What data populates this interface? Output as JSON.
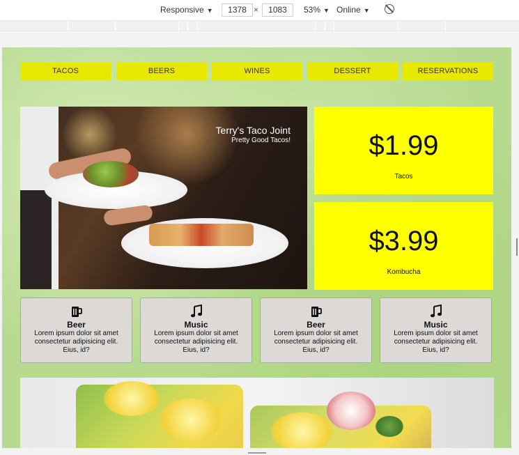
{
  "devtools": {
    "mode": "Responsive",
    "width": "1378",
    "times": "×",
    "height": "1083",
    "zoom": "53%",
    "network": "Online",
    "caret": "▼"
  },
  "nav": {
    "items": [
      {
        "label": "TACOS"
      },
      {
        "label": "BEERS"
      },
      {
        "label": "WINES"
      },
      {
        "label": "DESSERT"
      },
      {
        "label": "RESERVATIONS"
      }
    ]
  },
  "hero": {
    "title": "Terry's Taco Joint",
    "subtitle": "Pretty Good Tacos!"
  },
  "prices": [
    {
      "amount": "$1.99",
      "label": "Tacos"
    },
    {
      "amount": "$3.99",
      "label": "Kombucha"
    }
  ],
  "cards": [
    {
      "icon": "beer-mug-icon",
      "title": "Beer",
      "desc": "Lorem ipsum dolor sit amet consectetur adipisicing elit. Eius, id?"
    },
    {
      "icon": "music-note-icon",
      "title": "Music",
      "desc": "Lorem ipsum dolor sit amet consectetur adipisicing elit. Eius, id?"
    },
    {
      "icon": "beer-mug-icon",
      "title": "Beer",
      "desc": "Lorem ipsum dolor sit amet consectetur adipisicing elit. Eius, id?"
    },
    {
      "icon": "music-note-icon",
      "title": "Music",
      "desc": "Lorem ipsum dolor sit amet consectetur adipisicing elit. Eius, id?"
    }
  ],
  "colors": {
    "nav_bg": "#e8e800",
    "price_bg": "#ffff00",
    "card_bg": "#dcd9d7",
    "page_bg": "#b6da8f"
  }
}
